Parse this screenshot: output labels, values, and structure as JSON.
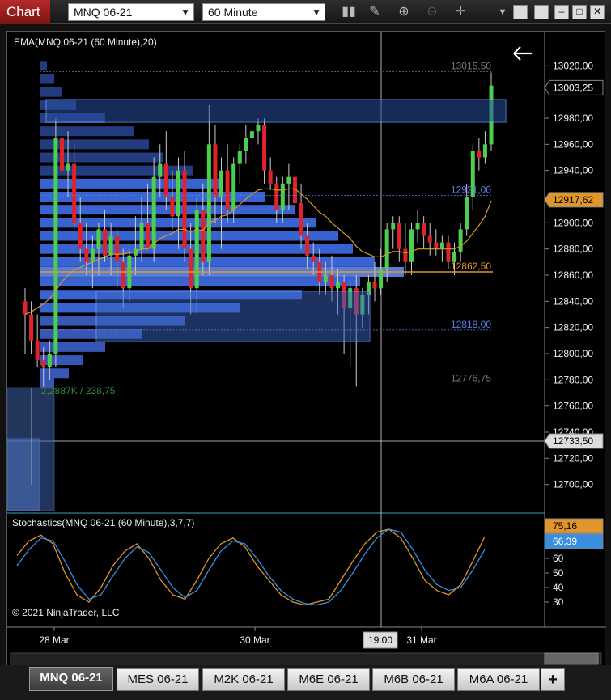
{
  "window": {
    "title": "Chart",
    "instrument": "MNQ 06-21",
    "interval": "60 Minute"
  },
  "icons": [
    "bar-style-icon",
    "draw-tool-icon",
    "zoom-in-icon",
    "zoom-out-icon",
    "crosshair-icon",
    "menu-dropdown-icon",
    "restore-icon",
    "minimize-icon",
    "maximize-icon",
    "close-icon"
  ],
  "price_panel": {
    "indicator_label": "EMA(MNQ 06-21 (60 Minute),20)",
    "copyright": "© 2021 NinjaTrader, LLC",
    "volume_label": "2,2887K / 238,75",
    "profile_labels": [
      "13015,50",
      "12921,00",
      "12862,50",
      "12818,00",
      "12776,75"
    ],
    "last_price": "13003,25",
    "ema_price": "12917,62",
    "crosshair_price": "12733,50",
    "y_ticks": [
      "13020,00",
      "12980,00",
      "12960,00",
      "12940,00",
      "12900,00",
      "12880,00",
      "12860,00",
      "12840,00",
      "12820,00",
      "12800,00",
      "12780,00",
      "12760,00",
      "12740,00",
      "12720,00",
      "12700,00"
    ]
  },
  "stoch_panel": {
    "label": "Stochastics(MNQ 06-21 (60 Minute),3,7,7)",
    "value_d": "75,16",
    "value_k": "66,39",
    "y_ticks": [
      "60",
      "50",
      "40",
      "30"
    ]
  },
  "x_axis": {
    "labels": [
      "28 Mar",
      "30 Mar",
      "31 Mar"
    ],
    "crosshair_time": "19.00"
  },
  "tabs": [
    {
      "label": "MNQ 06-21",
      "active": true
    },
    {
      "label": "MES 06-21",
      "active": false
    },
    {
      "label": "M2K 06-21",
      "active": false
    },
    {
      "label": "M6E 06-21",
      "active": false
    },
    {
      "label": "M6B 06-21",
      "active": false
    },
    {
      "label": "M6A 06-21",
      "active": false
    }
  ],
  "add_tab_label": "+",
  "colors": {
    "up_candle": "#4ccf4c",
    "down_candle": "#e0232b",
    "profile": "#3f6ee8",
    "ema": "#d69a2a",
    "stoch_d": "#e0962a",
    "stoch_k": "#3a8ee0",
    "poc": "#e0962a"
  },
  "chart_data": {
    "type": "candlestick",
    "y_range": [
      12680,
      13040
    ],
    "candles": [
      {
        "o": 12840,
        "h": 12850,
        "l": 12800,
        "c": 12830
      },
      {
        "o": 12830,
        "h": 12840,
        "l": 12800,
        "c": 12810
      },
      {
        "o": 12810,
        "h": 12830,
        "l": 12790,
        "c": 12795
      },
      {
        "o": 12795,
        "h": 12805,
        "l": 12775,
        "c": 12790
      },
      {
        "o": 12790,
        "h": 12810,
        "l": 12780,
        "c": 12800
      },
      {
        "o": 12800,
        "h": 12980,
        "l": 12790,
        "c": 12965
      },
      {
        "o": 12965,
        "h": 12990,
        "l": 12930,
        "c": 12940
      },
      {
        "o": 12940,
        "h": 12970,
        "l": 12920,
        "c": 12945
      },
      {
        "o": 12945,
        "h": 12960,
        "l": 12895,
        "c": 12900
      },
      {
        "o": 12900,
        "h": 12920,
        "l": 12870,
        "c": 12880
      },
      {
        "o": 12880,
        "h": 12900,
        "l": 12860,
        "c": 12870
      },
      {
        "o": 12870,
        "h": 12890,
        "l": 12850,
        "c": 12880
      },
      {
        "o": 12880,
        "h": 12900,
        "l": 12860,
        "c": 12895
      },
      {
        "o": 12895,
        "h": 12910,
        "l": 12870,
        "c": 12875
      },
      {
        "o": 12875,
        "h": 12900,
        "l": 12860,
        "c": 12890
      },
      {
        "o": 12890,
        "h": 12895,
        "l": 12850,
        "c": 12870
      },
      {
        "o": 12870,
        "h": 12880,
        "l": 12835,
        "c": 12850
      },
      {
        "o": 12850,
        "h": 12880,
        "l": 12840,
        "c": 12875
      },
      {
        "o": 12875,
        "h": 12905,
        "l": 12860,
        "c": 12880
      },
      {
        "o": 12880,
        "h": 12920,
        "l": 12870,
        "c": 12900
      },
      {
        "o": 12900,
        "h": 12930,
        "l": 12880,
        "c": 12880
      },
      {
        "o": 12880,
        "h": 12950,
        "l": 12870,
        "c": 12935
      },
      {
        "o": 12935,
        "h": 12960,
        "l": 12920,
        "c": 12945
      },
      {
        "o": 12945,
        "h": 12970,
        "l": 12910,
        "c": 12920
      },
      {
        "o": 12920,
        "h": 12940,
        "l": 12895,
        "c": 12905
      },
      {
        "o": 12905,
        "h": 12950,
        "l": 12880,
        "c": 12940
      },
      {
        "o": 12940,
        "h": 12955,
        "l": 12870,
        "c": 12880
      },
      {
        "o": 12880,
        "h": 12900,
        "l": 12830,
        "c": 12850
      },
      {
        "o": 12850,
        "h": 12920,
        "l": 12830,
        "c": 12910
      },
      {
        "o": 12910,
        "h": 12930,
        "l": 12860,
        "c": 12870
      },
      {
        "o": 12870,
        "h": 12990,
        "l": 12860,
        "c": 12960
      },
      {
        "o": 12960,
        "h": 12975,
        "l": 12900,
        "c": 12920
      },
      {
        "o": 12920,
        "h": 12950,
        "l": 12880,
        "c": 12940
      },
      {
        "o": 12940,
        "h": 12960,
        "l": 12900,
        "c": 12910
      },
      {
        "o": 12910,
        "h": 12950,
        "l": 12900,
        "c": 12945
      },
      {
        "o": 12945,
        "h": 12960,
        "l": 12930,
        "c": 12955
      },
      {
        "o": 12955,
        "h": 12975,
        "l": 12945,
        "c": 12965
      },
      {
        "o": 12965,
        "h": 12975,
        "l": 12955,
        "c": 12970
      },
      {
        "o": 12970,
        "h": 12980,
        "l": 12960,
        "c": 12975
      },
      {
        "o": 12975,
        "h": 12980,
        "l": 12930,
        "c": 12940
      },
      {
        "o": 12940,
        "h": 12950,
        "l": 12925,
        "c": 12930
      },
      {
        "o": 12930,
        "h": 12935,
        "l": 12900,
        "c": 12910
      },
      {
        "o": 12910,
        "h": 12935,
        "l": 12900,
        "c": 12930
      },
      {
        "o": 12930,
        "h": 12945,
        "l": 12910,
        "c": 12935
      },
      {
        "o": 12935,
        "h": 12940,
        "l": 12905,
        "c": 12915
      },
      {
        "o": 12915,
        "h": 12930,
        "l": 12880,
        "c": 12890
      },
      {
        "o": 12890,
        "h": 12900,
        "l": 12865,
        "c": 12875
      },
      {
        "o": 12875,
        "h": 12885,
        "l": 12860,
        "c": 12870
      },
      {
        "o": 12870,
        "h": 12880,
        "l": 12845,
        "c": 12855
      },
      {
        "o": 12855,
        "h": 12870,
        "l": 12845,
        "c": 12860
      },
      {
        "o": 12860,
        "h": 12875,
        "l": 12840,
        "c": 12850
      },
      {
        "o": 12850,
        "h": 12865,
        "l": 12830,
        "c": 12855
      },
      {
        "o": 12855,
        "h": 12860,
        "l": 12800,
        "c": 12835
      },
      {
        "o": 12835,
        "h": 12855,
        "l": 12790,
        "c": 12850
      },
      {
        "o": 12850,
        "h": 12860,
        "l": 12775,
        "c": 12830
      },
      {
        "o": 12830,
        "h": 12850,
        "l": 12820,
        "c": 12845
      },
      {
        "o": 12845,
        "h": 12860,
        "l": 12830,
        "c": 12855
      },
      {
        "o": 12855,
        "h": 12870,
        "l": 12840,
        "c": 12850
      },
      {
        "o": 12850,
        "h": 12880,
        "l": 12845,
        "c": 12865
      },
      {
        "o": 12865,
        "h": 12900,
        "l": 12855,
        "c": 12895
      },
      {
        "o": 12895,
        "h": 12905,
        "l": 12880,
        "c": 12900
      },
      {
        "o": 12900,
        "h": 12905,
        "l": 12870,
        "c": 12880
      },
      {
        "o": 12880,
        "h": 12900,
        "l": 12860,
        "c": 12870
      },
      {
        "o": 12870,
        "h": 12900,
        "l": 12860,
        "c": 12895
      },
      {
        "o": 12895,
        "h": 12910,
        "l": 12885,
        "c": 12900
      },
      {
        "o": 12900,
        "h": 12905,
        "l": 12880,
        "c": 12890
      },
      {
        "o": 12890,
        "h": 12900,
        "l": 12875,
        "c": 12885
      },
      {
        "o": 12885,
        "h": 12895,
        "l": 12875,
        "c": 12880
      },
      {
        "o": 12880,
        "h": 12890,
        "l": 12870,
        "c": 12885
      },
      {
        "o": 12885,
        "h": 12890,
        "l": 12865,
        "c": 12870
      },
      {
        "o": 12870,
        "h": 12885,
        "l": 12860,
        "c": 12878
      },
      {
        "o": 12878,
        "h": 12900,
        "l": 12870,
        "c": 12895
      },
      {
        "o": 12895,
        "h": 12930,
        "l": 12890,
        "c": 12920
      },
      {
        "o": 12920,
        "h": 12960,
        "l": 12910,
        "c": 12955
      },
      {
        "o": 12955,
        "h": 12965,
        "l": 12940,
        "c": 12950
      },
      {
        "o": 12950,
        "h": 12970,
        "l": 12945,
        "c": 12960
      },
      {
        "o": 12960,
        "h": 13015,
        "l": 12955,
        "c": 13005
      }
    ],
    "ema": [
      12830,
      12832,
      12835,
      12838,
      12842,
      12848,
      12855,
      12860,
      12864,
      12866,
      12868,
      12870,
      12872,
      12874,
      12876,
      12876,
      12876,
      12877,
      12878,
      12880,
      12880,
      12884,
      12888,
      12890,
      12892,
      12895,
      12895,
      12893,
      12895,
      12894,
      12900,
      12902,
      12905,
      12906,
      12910,
      12914,
      12918,
      12922,
      12925,
      12926,
      12926,
      12925,
      12925,
      12926,
      12926,
      12922,
      12918,
      12913,
      12908,
      12905,
      12900,
      12896,
      12892,
      12888,
      12882,
      12878,
      12876,
      12874,
      12874,
      12876,
      12878,
      12878,
      12877,
      12878,
      12880,
      12880,
      12880,
      12880,
      12880,
      12880,
      12880,
      12882,
      12886,
      12892,
      12898,
      12905,
      12917
    ],
    "volume_profile_bins": [
      {
        "price": 13020,
        "v": 0.02
      },
      {
        "price": 13010,
        "v": 0.04
      },
      {
        "price": 13000,
        "v": 0.06
      },
      {
        "price": 12990,
        "v": 0.1
      },
      {
        "price": 12980,
        "v": 0.18
      },
      {
        "price": 12970,
        "v": 0.26
      },
      {
        "price": 12960,
        "v": 0.3
      },
      {
        "price": 12950,
        "v": 0.34
      },
      {
        "price": 12940,
        "v": 0.42
      },
      {
        "price": 12930,
        "v": 0.5
      },
      {
        "price": 12920,
        "v": 0.62
      },
      {
        "price": 12910,
        "v": 0.7
      },
      {
        "price": 12900,
        "v": 0.76
      },
      {
        "price": 12890,
        "v": 0.82
      },
      {
        "price": 12880,
        "v": 0.86
      },
      {
        "price": 12870,
        "v": 0.92
      },
      {
        "price": 12862.5,
        "v": 1.0
      },
      {
        "price": 12855,
        "v": 0.88
      },
      {
        "price": 12845,
        "v": 0.72
      },
      {
        "price": 12835,
        "v": 0.55
      },
      {
        "price": 12825,
        "v": 0.4
      },
      {
        "price": 12815,
        "v": 0.28
      },
      {
        "price": 12805,
        "v": 0.18
      },
      {
        "price": 12795,
        "v": 0.12
      },
      {
        "price": 12785,
        "v": 0.08
      },
      {
        "price": 12778,
        "v": 0.04
      }
    ],
    "stoch_range": [
      20,
      80
    ],
    "stoch_d": [
      62,
      72,
      76,
      70,
      50,
      35,
      30,
      40,
      55,
      65,
      70,
      60,
      45,
      35,
      32,
      45,
      60,
      70,
      74,
      68,
      55,
      45,
      35,
      30,
      28,
      30,
      32,
      45,
      58,
      70,
      78,
      80,
      74,
      60,
      45,
      38,
      35,
      42,
      58,
      75
    ],
    "stoch_k": [
      55,
      66,
      74,
      72,
      58,
      42,
      32,
      35,
      48,
      60,
      68,
      64,
      52,
      40,
      33,
      38,
      52,
      65,
      72,
      70,
      60,
      48,
      38,
      32,
      29,
      28,
      30,
      38,
      50,
      63,
      74,
      80,
      78,
      66,
      52,
      42,
      38,
      40,
      52,
      66
    ]
  }
}
